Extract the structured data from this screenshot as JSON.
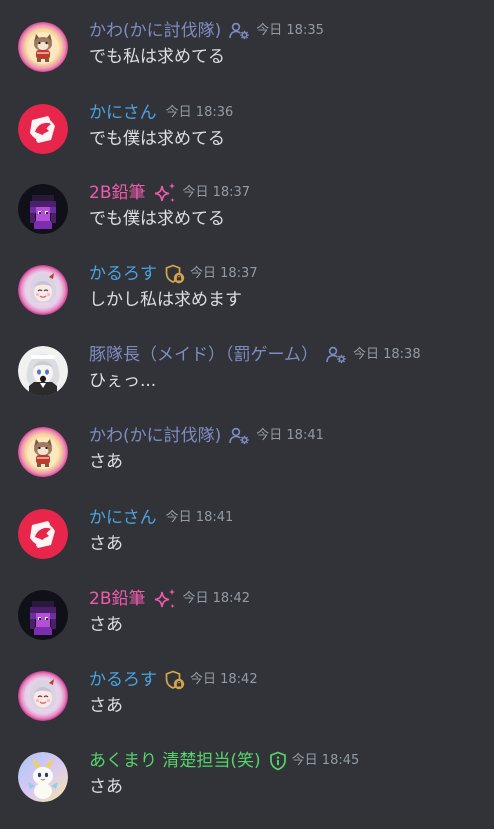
{
  "colors": {
    "background": "#313338",
    "timestamp": "#949ba4",
    "message_text": "#dbdee1",
    "name_blue_grey": "#7f8cc2",
    "name_blue": "#4aa3df",
    "name_pink": "#f25aae",
    "name_green": "#57d36b",
    "badge_gold": "#d4a54c"
  },
  "messages": [
    {
      "author": "かわ(かに討伐隊)",
      "name_color": "#7f8cc2",
      "badge_icon": "user-gear-icon",
      "timestamp": "今日 18:35",
      "text": "でも私は求めてる",
      "avatar_icon": "cat-avatar"
    },
    {
      "author": "かにさん",
      "name_color": "#4aa3df",
      "badge_icon": "",
      "timestamp": "今日 18:36",
      "text": "でも僕は求めてる",
      "avatar_icon": "crab-avatar"
    },
    {
      "author": "2B鉛筆",
      "name_color": "#f25aae",
      "badge_icon": "sparkle-icon",
      "timestamp": "今日 18:37",
      "text": "でも僕は求めてる",
      "avatar_icon": "pixel-character-avatar"
    },
    {
      "author": "かるろす",
      "name_color": "#4aa3df",
      "badge_icon": "shield-lock-icon",
      "timestamp": "今日 18:37",
      "text": "しかし私は求めます",
      "avatar_icon": "anime-girl-avatar"
    },
    {
      "author": "豚隊長（メイド）（罰ゲーム）",
      "name_color": "#7f8cc2",
      "badge_icon": "user-gear-icon",
      "timestamp": "今日 18:38",
      "text": "ひぇっ...",
      "avatar_icon": "maid-avatar"
    },
    {
      "author": "かわ(かに討伐隊)",
      "name_color": "#7f8cc2",
      "badge_icon": "user-gear-icon",
      "timestamp": "今日 18:41",
      "text": "さあ",
      "avatar_icon": "cat-avatar"
    },
    {
      "author": "かにさん",
      "name_color": "#4aa3df",
      "badge_icon": "",
      "timestamp": "今日 18:41",
      "text": "さあ",
      "avatar_icon": "crab-avatar"
    },
    {
      "author": "2B鉛筆",
      "name_color": "#f25aae",
      "badge_icon": "sparkle-icon",
      "timestamp": "今日 18:42",
      "text": "さあ",
      "avatar_icon": "pixel-character-avatar"
    },
    {
      "author": "かるろす",
      "name_color": "#4aa3df",
      "badge_icon": "shield-lock-icon",
      "timestamp": "今日 18:42",
      "text": "さあ",
      "avatar_icon": "anime-girl-avatar"
    },
    {
      "author": "あくまり 清楚担当(笑)",
      "name_color": "#57d36b",
      "badge_icon": "shield-info-icon",
      "timestamp": "今日 18:45",
      "text": "さあ",
      "avatar_icon": "cute-creature-avatar"
    }
  ]
}
